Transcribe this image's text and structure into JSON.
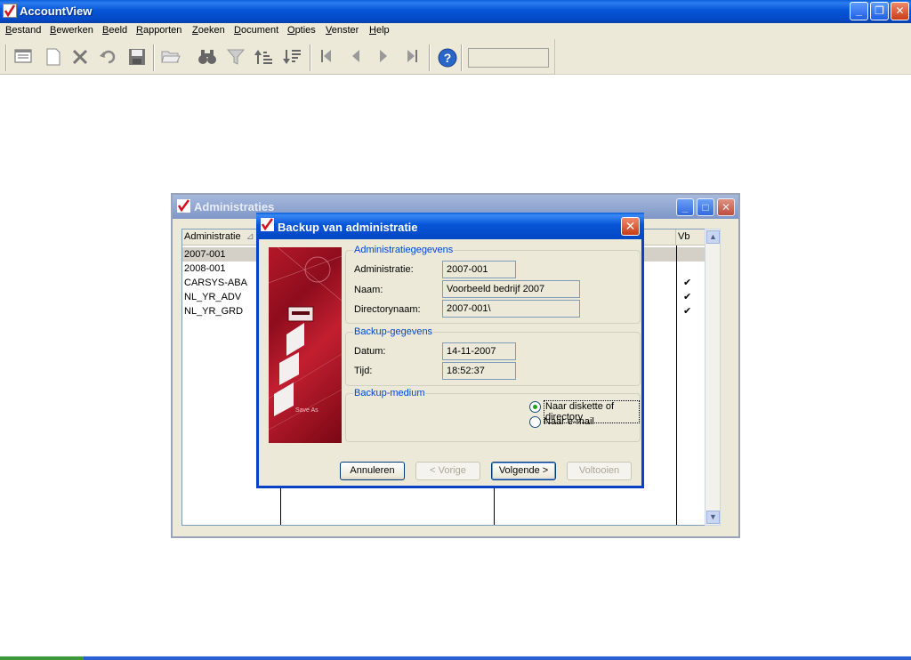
{
  "app": {
    "title": "AccountView",
    "controls": {
      "minimize": "_",
      "restore": "❐",
      "close": "✕"
    }
  },
  "menu": [
    "Bestand",
    "Bewerken",
    "Beeld",
    "Rapporten",
    "Zoeken",
    "Document",
    "Opties",
    "Venster",
    "Help"
  ],
  "toolbar": {
    "icons": [
      "form-icon",
      "new-document-icon",
      "delete-icon",
      "undo-icon",
      "save-icon",
      "open-folder-icon",
      "find-icon",
      "filter-icon",
      "sort-ascending-icon",
      "sort-descending-icon",
      "first-record-icon",
      "previous-record-icon",
      "next-record-icon",
      "last-record-icon",
      "help-icon"
    ],
    "field_value": ""
  },
  "admin_window": {
    "title": "Administraties",
    "columns": {
      "administratie": "Administratie",
      "vb": "Vb"
    },
    "sort_indicator": "⊿",
    "rows": [
      {
        "id": "2007-001",
        "vb": false,
        "selected": true
      },
      {
        "id": "2008-001",
        "vb": false,
        "selected": false
      },
      {
        "id": "CARSYS-ABA",
        "vb": true,
        "selected": false
      },
      {
        "id": "NL_YR_ADV",
        "vb": true,
        "selected": false
      },
      {
        "id": "NL_YR_GRD",
        "vb": true,
        "selected": false
      }
    ],
    "checkmark": "✔"
  },
  "dialog": {
    "title": "Backup van administratie",
    "close": "✕",
    "admin_group": {
      "label": "Administratiegegevens",
      "fields": [
        {
          "label": "Administratie:",
          "value": "2007-001"
        },
        {
          "label": "Naam:",
          "value": "Voorbeeld bedrijf 2007"
        },
        {
          "label": "Directorynaam:",
          "value": "2007-001\\"
        }
      ]
    },
    "backup_group": {
      "label": "Backup-gegevens",
      "fields": [
        {
          "label": "Datum:",
          "value": "14-11-2007"
        },
        {
          "label": "Tijd:",
          "value": "18:52:37"
        }
      ]
    },
    "medium_group": {
      "label": "Backup-medium",
      "options": [
        {
          "label": "Naar diskette of directory",
          "selected": true
        },
        {
          "label": "Naar e-mail",
          "selected": false
        }
      ]
    },
    "buttons": {
      "cancel": "Annuleren",
      "back": "< Vorige",
      "next": "Volgende >",
      "finish": "Voltooien"
    }
  }
}
